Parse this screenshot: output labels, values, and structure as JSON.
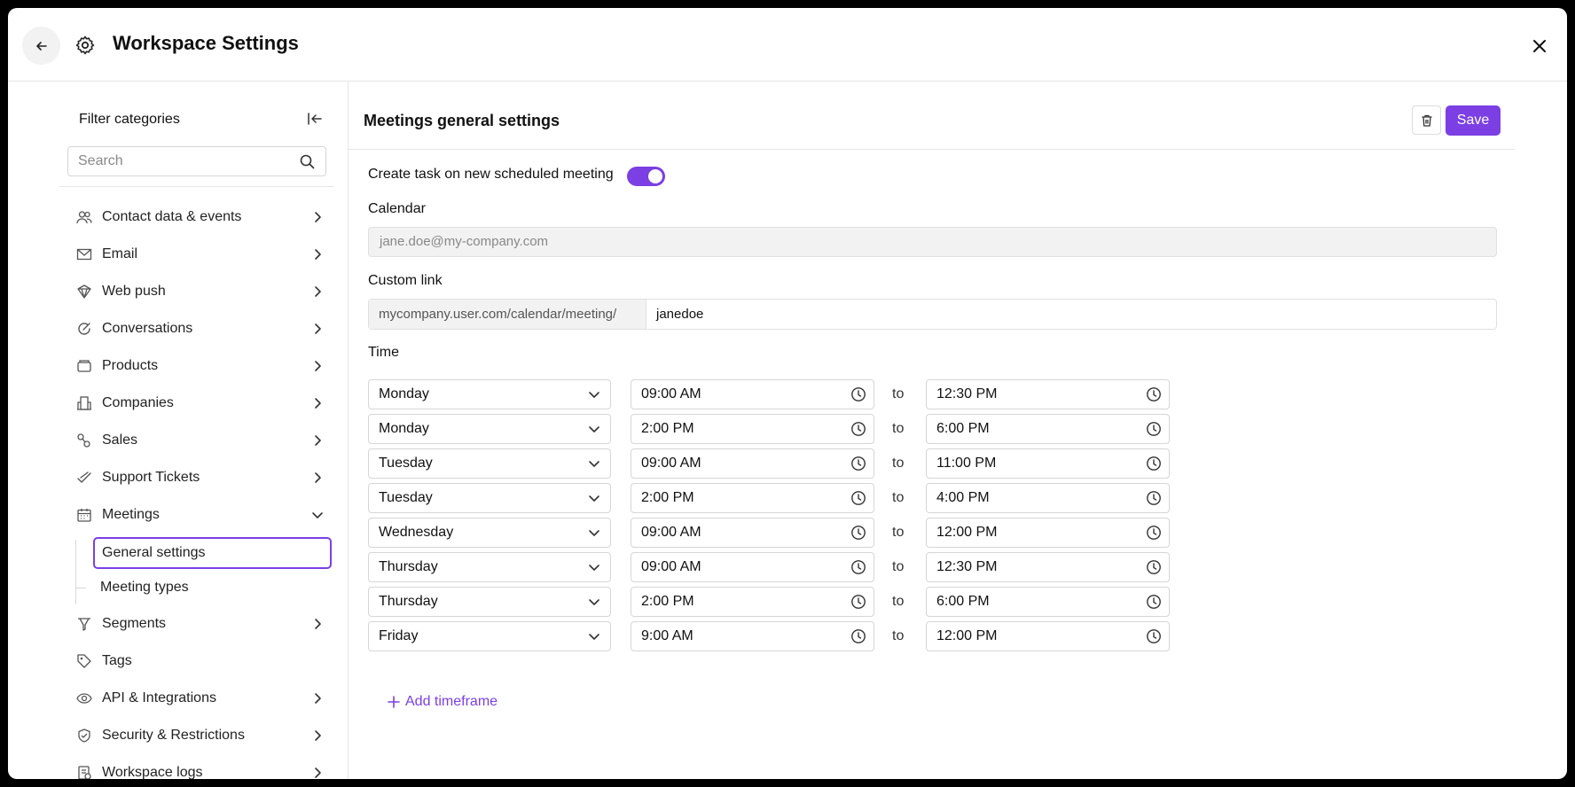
{
  "header": {
    "title": "Workspace Settings"
  },
  "sidebar": {
    "filter_title": "Filter categories",
    "search_placeholder": "Search",
    "items": [
      {
        "label": "Contact data & events",
        "icon": "users-icon"
      },
      {
        "label": "Email",
        "icon": "envelope-icon"
      },
      {
        "label": "Web push",
        "icon": "web-push-icon"
      },
      {
        "label": "Conversations",
        "icon": "chat-icon"
      },
      {
        "label": "Products",
        "icon": "box-icon"
      },
      {
        "label": "Companies",
        "icon": "building-icon"
      },
      {
        "label": "Sales",
        "icon": "sales-icon"
      },
      {
        "label": "Support Tickets",
        "icon": "ticket-check-icon"
      },
      {
        "label": "Meetings",
        "icon": "calendar-icon"
      },
      {
        "label": "Segments",
        "icon": "filter-icon"
      },
      {
        "label": "Tags",
        "icon": "tag-icon"
      },
      {
        "label": "API & Integrations",
        "icon": "api-icon"
      },
      {
        "label": "Security & Restrictions",
        "icon": "shield-icon"
      },
      {
        "label": "Workspace logs",
        "icon": "log-icon"
      }
    ],
    "meetings_sub": [
      {
        "label": "General settings",
        "active": true
      },
      {
        "label": "Meeting types",
        "active": false
      }
    ]
  },
  "main": {
    "title": "Meetings general settings",
    "save_label": "Save",
    "toggle_label": "Create task on new scheduled meeting",
    "toggle_on": true,
    "calendar_label": "Calendar",
    "calendar_value": "jane.doe@my-company.com",
    "custom_link_label": "Custom link",
    "custom_link_prefix": "mycompany.user.com/calendar/meeting/",
    "custom_link_value": "janedoe",
    "time_label": "Time",
    "to_word": "to",
    "add_timeframe": "Add timeframe",
    "timeframes": [
      {
        "day": "Monday",
        "from": "09:00 AM",
        "to": "12:30 PM"
      },
      {
        "day": "Monday",
        "from": "2:00 PM",
        "to": "6:00 PM"
      },
      {
        "day": "Tuesday",
        "from": "09:00 AM",
        "to": "11:00 PM"
      },
      {
        "day": "Tuesday",
        "from": "2:00 PM",
        "to": "4:00 PM"
      },
      {
        "day": "Wednesday",
        "from": "09:00 AM",
        "to": "12:00 PM"
      },
      {
        "day": "Thursday",
        "from": "09:00 AM",
        "to": "12:30 PM"
      },
      {
        "day": "Thursday",
        "from": "2:00 PM",
        "to": "6:00 PM"
      },
      {
        "day": "Friday",
        "from": "9:00 AM",
        "to": "12:00 PM"
      }
    ]
  },
  "colors": {
    "accent": "#7b3fe4"
  }
}
